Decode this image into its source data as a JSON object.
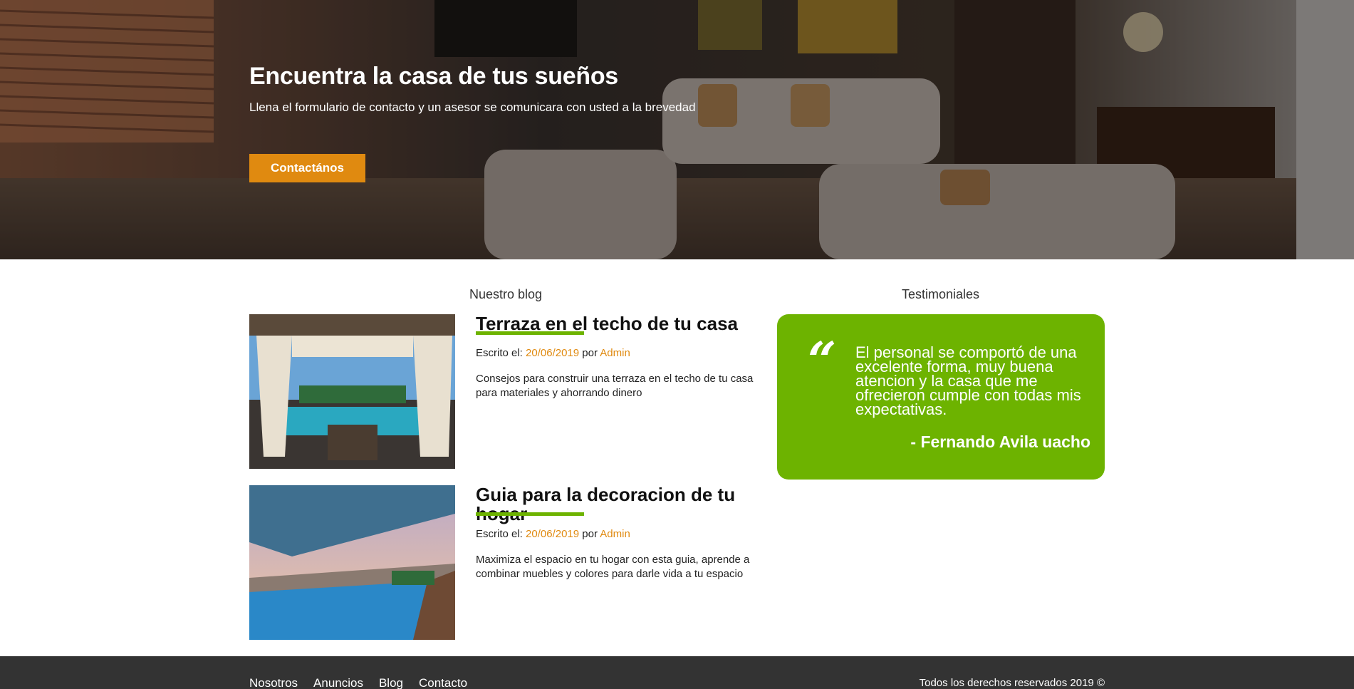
{
  "hero": {
    "title": "Encuentra la casa de tus sueños",
    "subtitle": "Llena el formulario de contacto y un asesor se comunicara con usted a la brevedad",
    "button_label": "Contactános"
  },
  "blog": {
    "heading": "Nuestro blog",
    "posts": [
      {
        "title": "Terraza en el techo de tu casa",
        "meta_prefix": "Escrito el: ",
        "date": "20/06/2019",
        "by": " por ",
        "author": "Admin",
        "description": "Consejos para construir una terraza en el techo de tu casa para materiales y ahorrando dinero"
      },
      {
        "title": "Guia para la decoracion de tu hogar",
        "meta_prefix": "Escrito el: ",
        "date": "20/06/2019",
        "by": " por ",
        "author": "Admin",
        "description": "Maximiza el espacio en tu hogar con esta guia, aprende a combinar muebles y colores para darle vida a tu espacio"
      }
    ]
  },
  "testimonials": {
    "heading": "Testimoniales",
    "quote_mark": "“",
    "text": "El personal se comportó de una excelente forma, muy buena atencion y la casa que me ofrecieron cumple con todas mis expectativas.",
    "author": "- Fernando Avila uacho"
  },
  "footer": {
    "nav": [
      "Nosotros",
      "Anuncios",
      "Blog",
      "Contacto"
    ],
    "copyright": "Todos los derechos reservados 2019 ©"
  },
  "colors": {
    "accent_orange": "#e08a10",
    "accent_green": "#6db300",
    "footer_bg": "#333333"
  }
}
